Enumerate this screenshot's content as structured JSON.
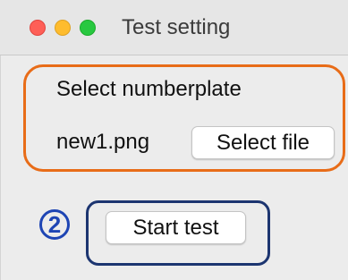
{
  "window": {
    "title": "Test setting"
  },
  "numberplate": {
    "heading": "Select numberplate",
    "file_name": "new1.png",
    "select_file_label": "Select file"
  },
  "test": {
    "step_marker": "2",
    "start_test_label": "Start test"
  },
  "colors": {
    "highlight_orange": "#e86c18",
    "highlight_blue": "#1c3570",
    "step_marker": "#1e45b4"
  },
  "icons": {
    "close": "close-traffic-light-icon",
    "minimize": "minimize-traffic-light-icon",
    "maximize": "maximize-traffic-light-icon"
  }
}
